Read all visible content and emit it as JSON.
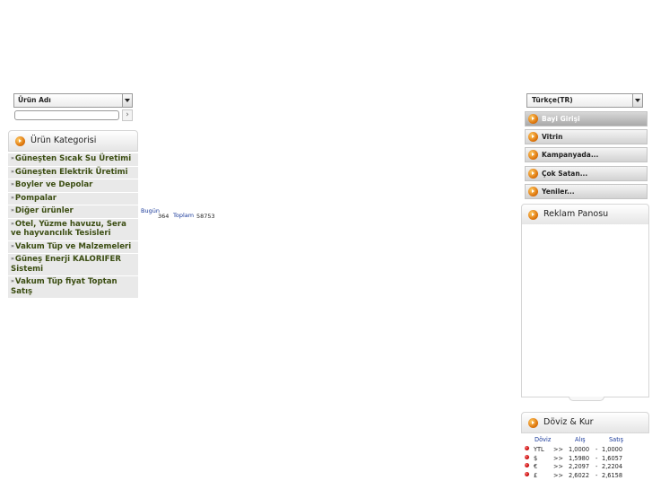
{
  "search": {
    "dropdown_value": "Ürün Adı",
    "input_value": "",
    "go_symbol": "›"
  },
  "categories_panel": {
    "title": "Ürün Kategorisi",
    "items": [
      {
        "label": "Güneşten Sıcak Su Üretimi"
      },
      {
        "label": "Güneşten Elektrik Üretimi"
      },
      {
        "label": "Boyler ve Depolar"
      },
      {
        "label": "Pompalar"
      },
      {
        "label": "Diğer ürünler"
      },
      {
        "label": "Otel, Yüzme havuzu, Sera ve hayvancılık Tesisleri"
      },
      {
        "label": "Vakum Tüp ve Malzemeleri"
      },
      {
        "label": "Güneş Enerji KALORIFER Sistemi"
      },
      {
        "label": "Vakum Tüp fiyat Toptan Satış"
      }
    ],
    "chevron": "»"
  },
  "stats": {
    "today_label": "Bugün",
    "today_value": "364",
    "total_label": "Toplam",
    "total_value": "58753"
  },
  "language": {
    "selected": "Türkçe(TR)"
  },
  "menu": {
    "items": [
      {
        "label": "Bayi Girişi"
      },
      {
        "label": "Vitrin"
      },
      {
        "label": "Kampanyada..."
      },
      {
        "label": "Çok Satan..."
      },
      {
        "label": "Yeniler..."
      }
    ]
  },
  "ad_panel": {
    "title": "Reklam Panosu"
  },
  "currency_panel": {
    "title": "Döviz & Kur",
    "headers": {
      "currency": "Döviz",
      "buy": "Alış",
      "sell": "Satış"
    },
    "rows": [
      {
        "code": "YTL",
        "arrow": ">>",
        "buy": "1,0000",
        "sep": "-",
        "sell": "1,0000"
      },
      {
        "code": "$",
        "arrow": ">>",
        "buy": "1,5980",
        "sep": "-",
        "sell": "1,6057"
      },
      {
        "code": "€",
        "arrow": ">>",
        "buy": "2,2097",
        "sep": "-",
        "sell": "2,2204"
      },
      {
        "code": "£",
        "arrow": ">>",
        "buy": "2,6022",
        "sep": "-",
        "sell": "2,6158"
      }
    ]
  },
  "colors": {
    "accent_orange": "#e07a10",
    "category_text": "#3b4d12",
    "link_blue": "#1a3a9a",
    "bullet_red": "#c00000"
  }
}
